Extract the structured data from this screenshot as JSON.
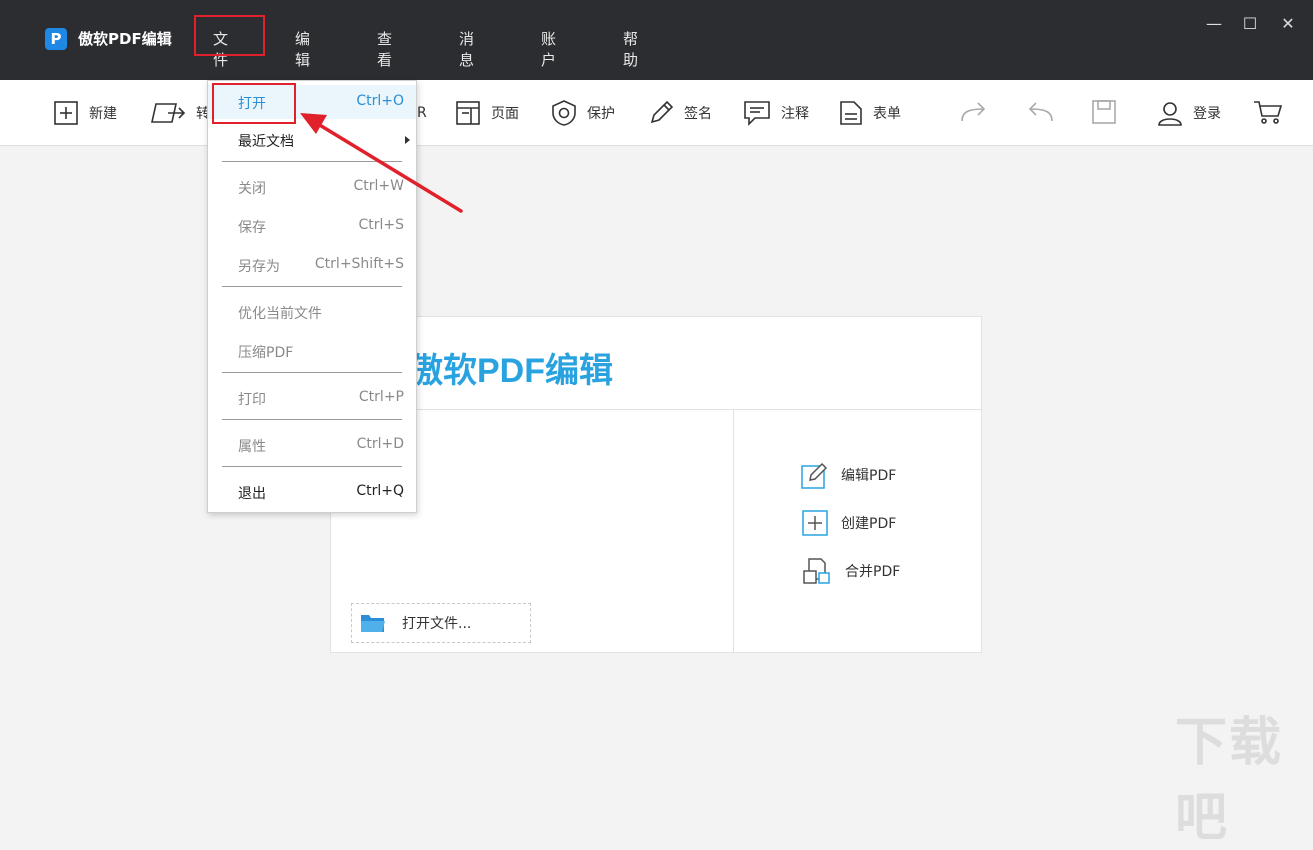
{
  "app": {
    "title": "傲软PDF编辑",
    "logo_letter": "P"
  },
  "menubar": {
    "items": [
      "文件",
      "编辑",
      "查看",
      "消息",
      "账户",
      "帮助"
    ]
  },
  "window_controls": {
    "minimize": "—",
    "maximize": "☐",
    "close": "✕"
  },
  "toolbar": {
    "new": "新建",
    "convert": "转",
    "ocr": "R",
    "page": "页面",
    "protect": "保护",
    "sign": "签名",
    "comment": "注释",
    "form": "表单",
    "login": "登录"
  },
  "file_menu": {
    "items": [
      {
        "label": "打开",
        "shortcut": "Ctrl+O"
      },
      {
        "label": "最近文档",
        "shortcut": ""
      },
      {
        "label": "关闭",
        "shortcut": "Ctrl+W"
      },
      {
        "label": "保存",
        "shortcut": "Ctrl+S"
      },
      {
        "label": "另存为",
        "shortcut": "Ctrl+Shift+S"
      },
      {
        "label": "优化当前文件",
        "shortcut": ""
      },
      {
        "label": "压缩PDF",
        "shortcut": ""
      },
      {
        "label": "打印",
        "shortcut": "Ctrl+P"
      },
      {
        "label": "属性",
        "shortcut": "Ctrl+D"
      },
      {
        "label": "退出",
        "shortcut": "Ctrl+Q"
      }
    ]
  },
  "welcome": {
    "title": "傲软PDF编辑",
    "open_file": "打开文件...",
    "quick_actions": [
      "编辑PDF",
      "创建PDF",
      "合并PDF"
    ]
  },
  "colors": {
    "titlebar": "#2b2d30",
    "accent": "#29a3e0",
    "highlight_box": "#e0212b"
  },
  "watermark": "下载吧"
}
